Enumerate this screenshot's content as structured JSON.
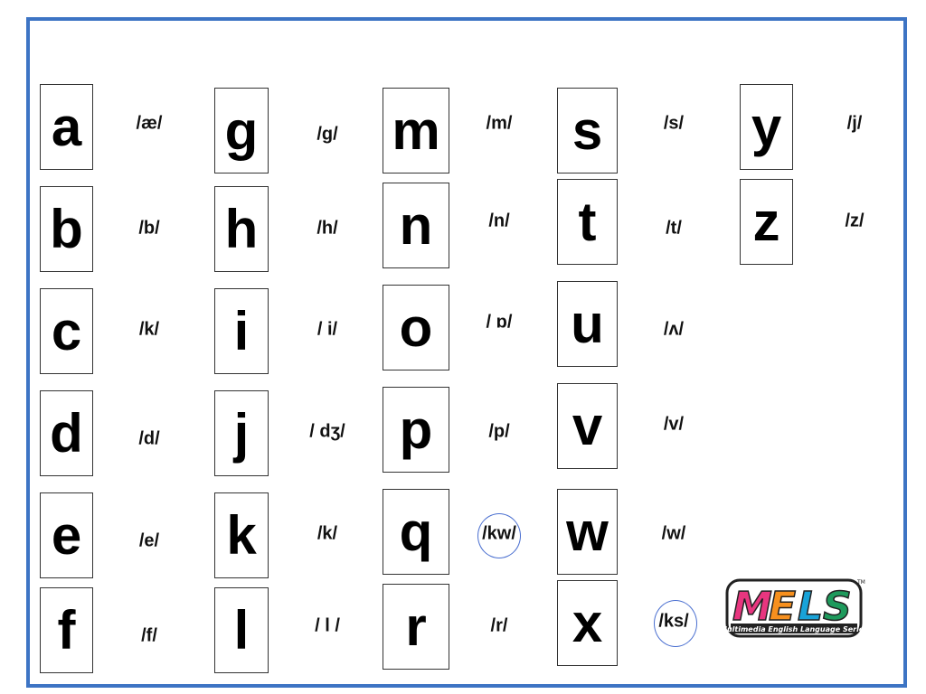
{
  "columns": [
    {
      "letters": [
        "a",
        "b",
        "c",
        "d",
        "e",
        "f"
      ],
      "sounds": [
        "/æ/",
        "/b/",
        "/k/",
        "/d/",
        "/e/",
        "/f/"
      ]
    },
    {
      "letters": [
        "g",
        "h",
        "i",
        "j",
        "k",
        "l"
      ],
      "sounds": [
        "/g/",
        "/h/",
        "/ i/",
        "/ dʒ/",
        "/k/",
        "/ l /"
      ]
    },
    {
      "letters": [
        "m",
        "n",
        "o",
        "p",
        "q",
        "r"
      ],
      "sounds": [
        "/m/",
        "/n/",
        "/ ɒ/",
        "/p/",
        "/kw/",
        "/r/"
      ]
    },
    {
      "letters": [
        "s",
        "t",
        "u",
        "v",
        "w",
        "x"
      ],
      "sounds": [
        "/s/",
        "/t/",
        "/ʌ/",
        "/v/",
        "/w/",
        "/ks/"
      ]
    },
    {
      "letters": [
        "y",
        "z"
      ],
      "sounds": [
        "/j/",
        "/z/"
      ]
    }
  ],
  "logo": {
    "text": "MELS",
    "tagline": "Multimedia English Language Series",
    "tm": "TM"
  },
  "colors": {
    "frame": "#3d74c4",
    "circle": "#4a6fd0",
    "logo_m": "#e8367f",
    "logo_e": "#f7901e",
    "logo_l": "#19a3d8",
    "logo_s": "#1e9a5c"
  }
}
